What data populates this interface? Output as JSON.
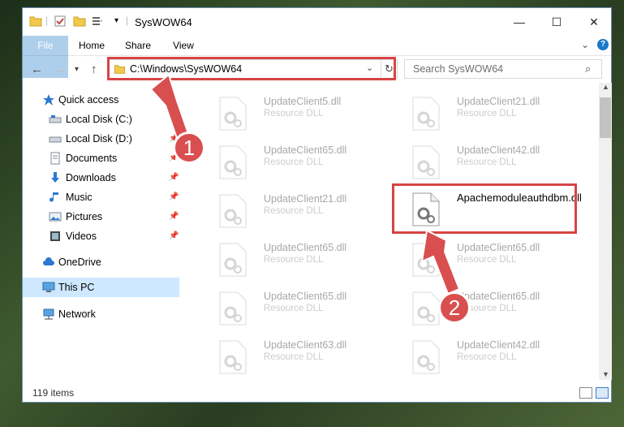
{
  "window": {
    "title": "SysWOW64"
  },
  "ribbon": {
    "tabs": [
      "File",
      "Home",
      "Share",
      "View"
    ]
  },
  "address": {
    "path": "C:\\Windows\\SysWOW64"
  },
  "search": {
    "placeholder": "Search SysWOW64"
  },
  "sidebar": {
    "items": [
      {
        "label": "Quick access",
        "icon": "star-icon"
      },
      {
        "label": "Local Disk (C:)",
        "icon": "drive-icon"
      },
      {
        "label": "Local Disk (D:)",
        "icon": "drive-icon"
      },
      {
        "label": "Documents",
        "icon": "documents-icon"
      },
      {
        "label": "Downloads",
        "icon": "downloads-icon"
      },
      {
        "label": "Music",
        "icon": "music-icon"
      },
      {
        "label": "Pictures",
        "icon": "pictures-icon"
      },
      {
        "label": "Videos",
        "icon": "videos-icon"
      },
      {
        "label": "OneDrive",
        "icon": "cloud-icon"
      },
      {
        "label": "This PC",
        "icon": "computer-icon"
      },
      {
        "label": "Network",
        "icon": "network-icon"
      }
    ]
  },
  "files": [
    {
      "name": "UpdateClient5.dll",
      "type": "Resource DLL"
    },
    {
      "name": "UpdateClient21.dll",
      "type": "Resource DLL"
    },
    {
      "name": "UpdateClient65.dll",
      "type": "Resource DLL"
    },
    {
      "name": "UpdateClient42.dll",
      "type": "Resource DLL"
    },
    {
      "name": "UpdateClient21.dll",
      "type": "Resource DLL"
    },
    {
      "name": "Apachemoduleauthdbm.dll",
      "type": ""
    },
    {
      "name": "UpdateClient65.dll",
      "type": "Resource DLL"
    },
    {
      "name": "UpdateClient65.dll",
      "type": "Resource DLL"
    },
    {
      "name": "UpdateClient65.dll",
      "type": "Resource DLL"
    },
    {
      "name": "UpdateClient65.dll",
      "type": "Resource DLL"
    },
    {
      "name": "UpdateClient63.dll",
      "type": "Resource DLL"
    },
    {
      "name": "UpdateClient42.dll",
      "type": "Resource DLL"
    }
  ],
  "status": {
    "count": "119 items"
  },
  "annotations": {
    "step1": "1",
    "step2": "2"
  },
  "colors": {
    "accent": "#1979ca",
    "highlight": "#d74444",
    "selected": "#cde8ff"
  }
}
